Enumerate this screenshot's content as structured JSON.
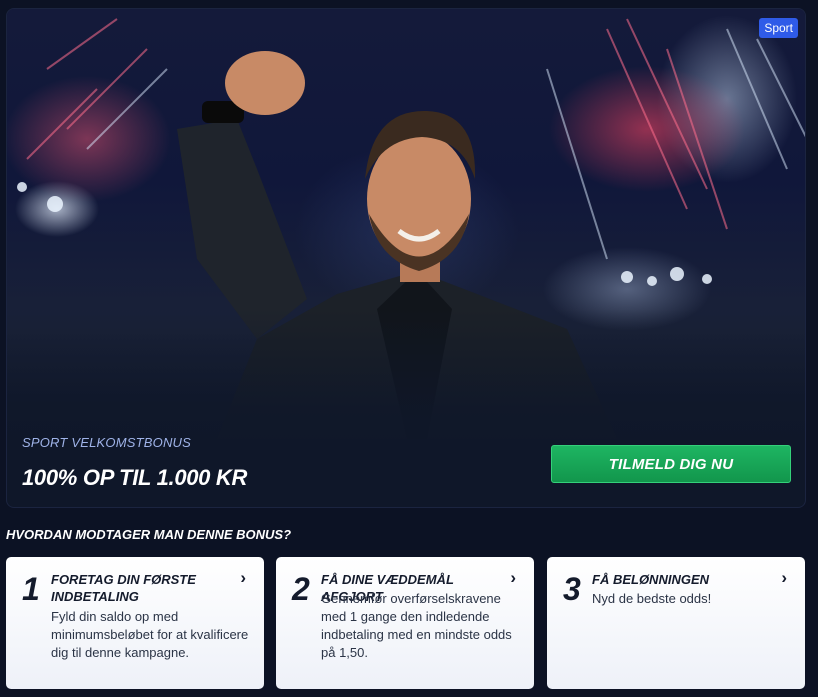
{
  "hero": {
    "badge": "Sport",
    "subtitle": "SPORT VELKOMSTBONUS",
    "title": "100% OP TIL 1.000 KR",
    "cta_label": "TILMELD DIG NU"
  },
  "how": {
    "title": "HVORDAN MODTAGER MAN DENNE BONUS?"
  },
  "steps": [
    {
      "number": "1",
      "title": "FORETAG DIN FØRSTE INDBETALING",
      "body": "Fyld din saldo op med minimumsbeløbet for at kvalificere dig til denne kampagne."
    },
    {
      "number": "2",
      "title": "FÅ DINE VÆDDEMÅL AFGJORT",
      "body": "Gennemfør overførselskravene med 1 gange den indledende indbetaling med en mindste odds på 1,50."
    },
    {
      "number": "3",
      "title": "FÅ BELØNNINGEN",
      "body": "Nyd de bedste odds!"
    }
  ],
  "colors": {
    "background": "#0c1224",
    "cta_green": "#12964c",
    "badge_blue": "#2f5be8"
  },
  "icons": {
    "step_chevron": "chevron-right-icon"
  }
}
